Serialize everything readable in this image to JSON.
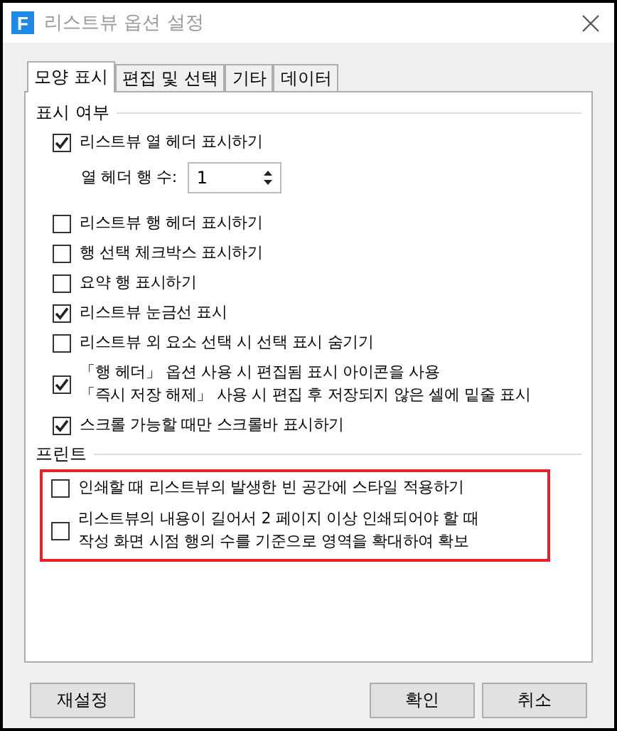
{
  "window": {
    "title": "리스트뷰 옵션 설정",
    "logo": "F"
  },
  "tabs": [
    {
      "label": "모양 표시",
      "selected": true
    },
    {
      "label": "편집 및 선택",
      "selected": false
    },
    {
      "label": "기타",
      "selected": false
    },
    {
      "label": "데이터",
      "selected": false
    }
  ],
  "display_section": {
    "title": "표시 여부",
    "items": [
      {
        "kind": "checkbox",
        "label": "리스트뷰 열 헤더 표시하기",
        "checked": true
      },
      {
        "kind": "spinner",
        "label": "열 헤더 행 수:",
        "value": "1"
      },
      {
        "kind": "checkbox",
        "label": "리스트뷰 행 헤더 표시하기",
        "checked": false
      },
      {
        "kind": "checkbox",
        "label": "행 선택 체크박스 표시하기",
        "checked": false
      },
      {
        "kind": "checkbox",
        "label": "요약 행 표시하기",
        "checked": false
      },
      {
        "kind": "checkbox",
        "label": "리스트뷰 눈금선 표시",
        "checked": true
      },
      {
        "kind": "checkbox",
        "label": "리스트뷰 외 요소 선택 시 선택 표시 숨기기",
        "checked": false
      },
      {
        "kind": "checkbox",
        "label": "「행 헤더」 옵션 사용 시 편집됨 표시 아이콘을 사용\n「즉시 저장 해제」 사용 시 편집 후 저장되지 않은 셀에 밑줄 표시",
        "checked": true
      },
      {
        "kind": "checkbox",
        "label": "스크롤 가능할 때만 스크롤바 표시하기",
        "checked": true
      }
    ]
  },
  "print_section": {
    "title": "프린트",
    "highlighted": true,
    "items": [
      {
        "kind": "checkbox",
        "label": "인쇄할 때 리스트뷰의 발생한 빈 공간에 스타일 적용하기",
        "checked": false
      },
      {
        "kind": "checkbox",
        "label": "리스트뷰의 내용이 길어서 2 페이지 이상 인쇄되어야 할 때\n작성 화면 시점 행의 수를 기준으로 영역을 확대하여 확보",
        "checked": false
      }
    ]
  },
  "buttons": [
    {
      "label": "재설정"
    },
    {
      "label": "확인"
    },
    {
      "label": "취소"
    }
  ]
}
